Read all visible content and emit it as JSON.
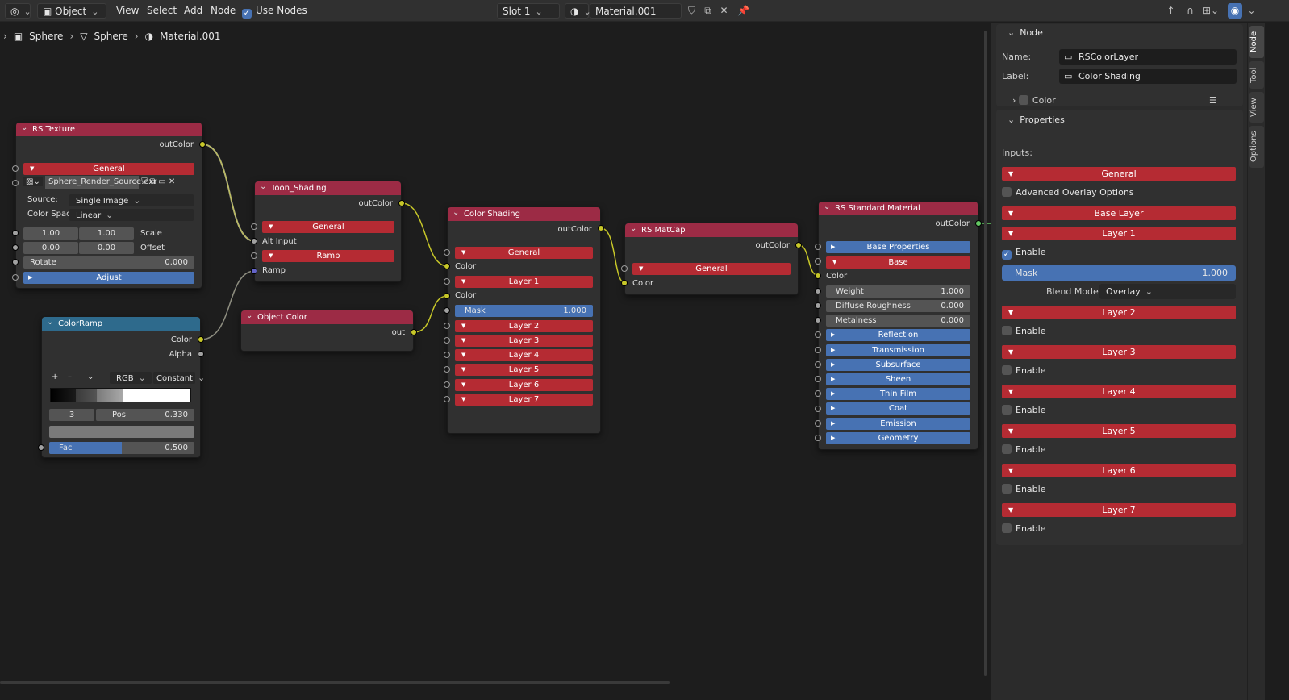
{
  "header": {
    "mode": "Object",
    "menus": [
      "View",
      "Select",
      "Add",
      "Node"
    ],
    "use_nodes": "Use Nodes",
    "slot": "Slot 1",
    "material": "Material.001"
  },
  "breadcrumb": [
    "Sphere",
    "Sphere",
    "Material.001"
  ],
  "nodes": {
    "rs_texture": {
      "title": "RS Texture",
      "out": "outColor",
      "general": "General",
      "filename": "Sphere_Render_Source.exr",
      "source_label": "Source:",
      "source_value": "Single Image",
      "colorspace_label": "Color Space:",
      "colorspace_value": "Linear",
      "scale_a": "1.00",
      "scale_b": "1.00",
      "scale_label": "Scale",
      "offset_a": "0.00",
      "offset_b": "0.00",
      "offset_label": "Offset",
      "rotate_label": "Rotate",
      "rotate_value": "0.000",
      "adjust": "Adjust"
    },
    "toon": {
      "title": "Toon_Shading",
      "out": "outColor",
      "general": "General",
      "alt_input": "Alt Input",
      "ramp_panel": "Ramp",
      "ramp": "Ramp"
    },
    "colorramp": {
      "title": "ColorRamp",
      "color": "Color",
      "alpha": "Alpha",
      "plus": "+",
      "minus": "–",
      "mode": "RGB",
      "interp": "Constant",
      "index": "3",
      "pos_label": "Pos",
      "pos_value": "0.330",
      "fac_label": "Fac",
      "fac_value": "0.500",
      "fac_fraction": 0.5
    },
    "object_color": {
      "title": "Object Color",
      "out": "out"
    },
    "color_shading": {
      "title": "Color Shading",
      "out": "outColor",
      "general": "General",
      "color": "Color",
      "layer1": "Layer 1",
      "color2": "Color",
      "mask_label": "Mask",
      "mask_value": "1.000",
      "layers": [
        "Layer 2",
        "Layer 3",
        "Layer 4",
        "Layer 5",
        "Layer 6",
        "Layer 7"
      ]
    },
    "matcap": {
      "title": "RS MatCap",
      "out": "outColor",
      "general": "General",
      "color": "Color"
    },
    "standard": {
      "title": "RS Standard Material",
      "out": "outColor",
      "base_props": "Base Properties",
      "base": "Base",
      "color": "Color",
      "weight_label": "Weight",
      "weight_value": "1.000",
      "rough_label": "Diffuse Roughness",
      "rough_value": "0.000",
      "metal_label": "Metalness",
      "metal_value": "0.000",
      "panels": [
        "Reflection",
        "Transmission",
        "Subsurface",
        "Sheen",
        "Thin Film",
        "Coat",
        "Emission",
        "Geometry"
      ]
    }
  },
  "sidebar": {
    "node_section": "Node",
    "name_label": "Name:",
    "name_value": "RSColorLayer",
    "label_label": "Label:",
    "label_value": "Color Shading",
    "color_label": "Color",
    "props_section": "Properties",
    "inputs_label": "Inputs:",
    "general": "General",
    "advanced": "Advanced Overlay Options",
    "base_layer": "Base Layer",
    "layer1": "Layer 1",
    "enable": "Enable",
    "mask_label": "Mask",
    "mask_value": "1.000",
    "blend_label": "Blend Mode",
    "blend_value": "Overlay",
    "layer2": "Layer 2",
    "layer3": "Layer 3",
    "layer4": "Layer 4",
    "layer5": "Layer 5",
    "layer6": "Layer 6",
    "layer7": "Layer 7"
  },
  "tabs": [
    "Node",
    "Tool",
    "View",
    "Options"
  ]
}
